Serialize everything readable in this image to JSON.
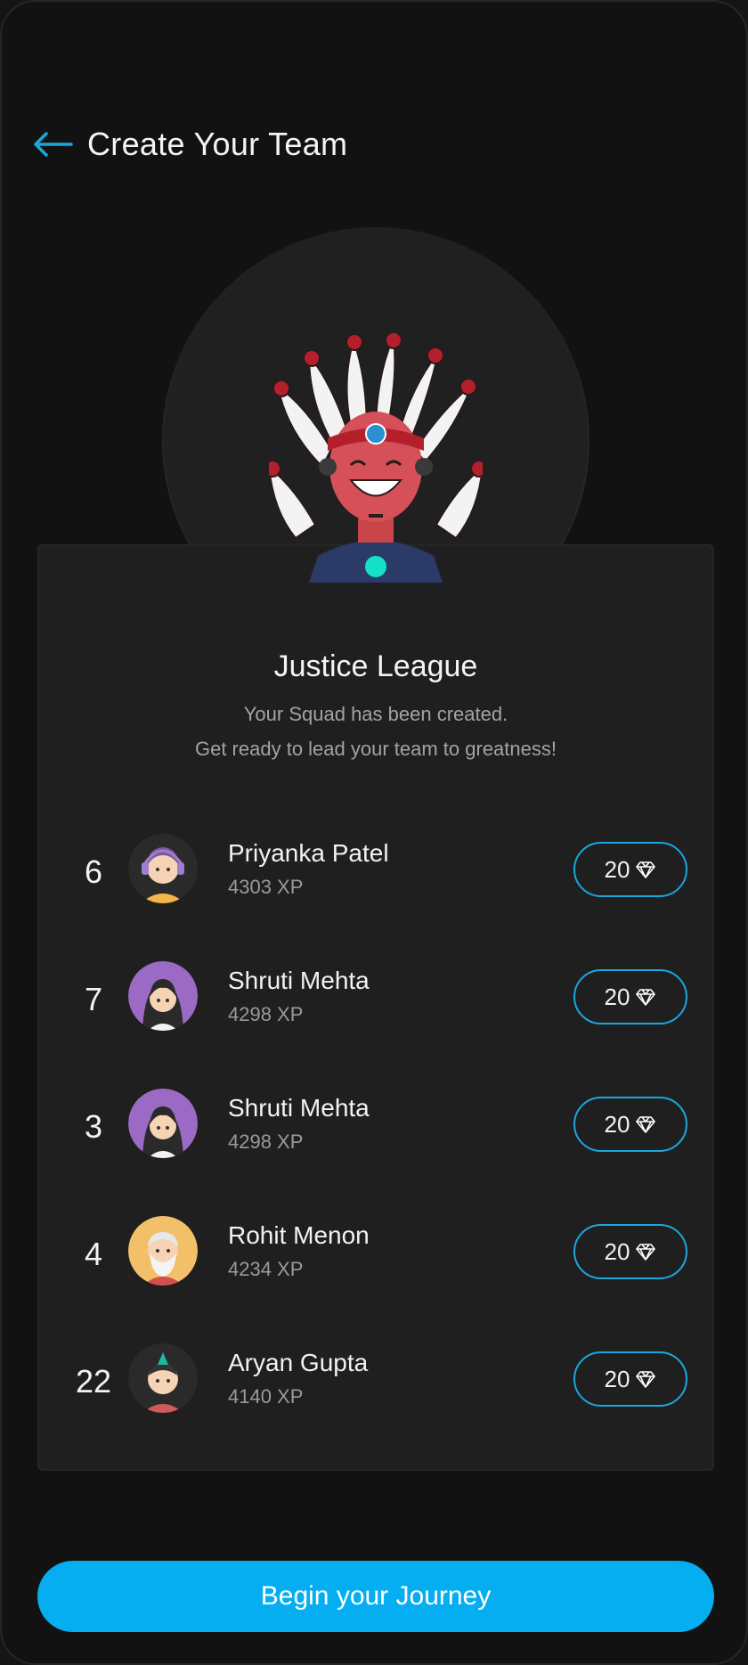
{
  "header": {
    "title": "Create Your Team"
  },
  "team": {
    "name": "Justice League",
    "subtitle_line1": "Your Squad has been created.",
    "subtitle_line2": "Get ready to lead your team to greatness!"
  },
  "members": [
    {
      "rank": "6",
      "name": "Priyanka Patel",
      "xp": "4303 XP",
      "gems": "20",
      "avatar": "girl-headphones-avatar"
    },
    {
      "rank": "7",
      "name": "Shruti Mehta",
      "xp": "4298 XP",
      "gems": "20",
      "avatar": "girl-long-hair-avatar"
    },
    {
      "rank": "3",
      "name": "Shruti Mehta",
      "xp": "4298 XP",
      "gems": "20",
      "avatar": "girl-long-hair-avatar"
    },
    {
      "rank": "4",
      "name": "Rohit Menon",
      "xp": "4234 XP",
      "gems": "20",
      "avatar": "old-man-beard-avatar"
    },
    {
      "rank": "22",
      "name": "Aryan Gupta",
      "xp": "4140 XP",
      "gems": "20",
      "avatar": "boy-mohawk-avatar"
    }
  ],
  "cta": {
    "label": "Begin your Journey"
  },
  "colors": {
    "accent": "#05aef0",
    "background": "#121212",
    "card": "#1f1f1f",
    "gem_border": "#1aa7e0"
  }
}
